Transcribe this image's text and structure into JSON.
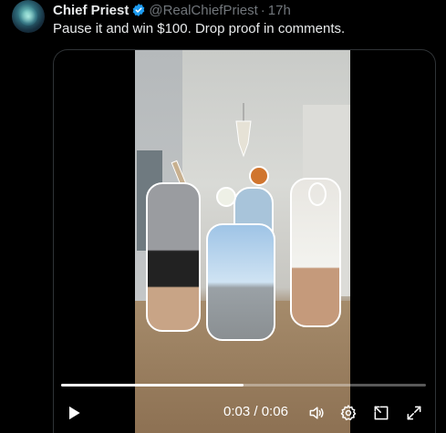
{
  "tweet": {
    "author_name": "Chief Priest",
    "handle": "@RealChiefPriest",
    "separator": "·",
    "time": "17h",
    "text": "Pause it and win $100. Drop proof in comments.",
    "verified_color": "#1d9bf0"
  },
  "video": {
    "current_time": "0:03",
    "time_separator": "/",
    "duration": "0:06",
    "progress_fraction": 0.5,
    "icons": {
      "play": "play-icon",
      "volume": "volume-icon",
      "settings": "gear-icon",
      "popout": "popout-icon",
      "fullscreen": "fullscreen-icon"
    }
  },
  "colors": {
    "background": "#000000",
    "text": "#e7e9ea",
    "muted": "#71767b",
    "border": "#2f3336"
  }
}
